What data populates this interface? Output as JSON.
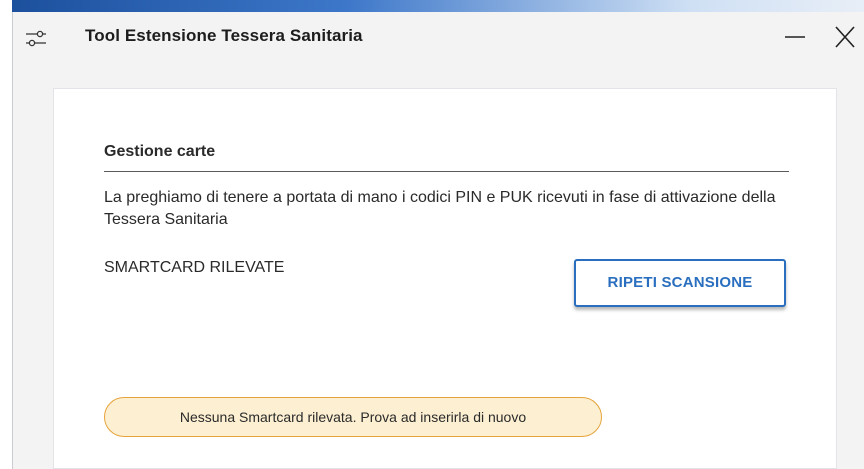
{
  "window": {
    "title": "Tool Estensione Tessera Sanitaria",
    "app_icon": "sliders-icon",
    "minimize_icon": "minimize-icon",
    "close_icon": "close-icon"
  },
  "section": {
    "title": "Gestione carte",
    "description": "La preghiamo di tenere a portata di mano i codici PIN e PUK ricevuti in fase di attivazione della Tessera Sanitaria",
    "smartcard_label": "SMARTCARD RILEVATE",
    "rescan_label": "RIPETI SCANSIONE"
  },
  "alert": {
    "message": "Nessuna Smartcard rilevata. Prova ad inserirla di nuovo"
  },
  "colors": {
    "accent": "#2a6fbf",
    "alert_background": "#fdf0d2",
    "alert_border": "#e6a33a"
  }
}
